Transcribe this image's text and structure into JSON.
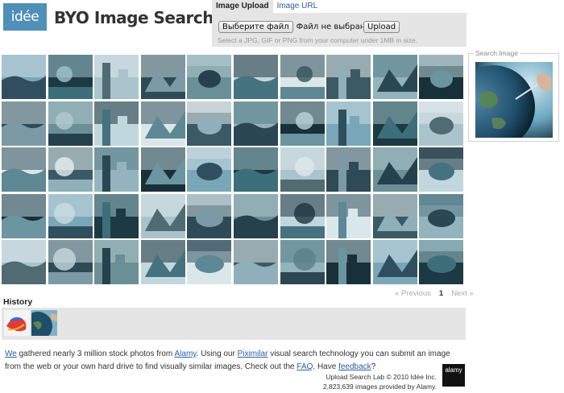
{
  "header": {
    "logo_text": "idée",
    "title": "BYO Image Search Lab"
  },
  "upload": {
    "tabs": [
      {
        "label": "Image Upload",
        "active": true
      },
      {
        "label": "Image URL",
        "active": false
      }
    ],
    "choose_file_label": "Выберите файл",
    "file_status": "Файл не выбран",
    "upload_button": "Upload",
    "hint": "Select a JPG, GIF or PNG from your computer under 1MB in size."
  },
  "search_image": {
    "legend": "Search Image"
  },
  "results": {
    "pager": {
      "previous": "« Previous",
      "current": "1",
      "next": "Next »"
    }
  },
  "history": {
    "title": "History"
  },
  "footer": {
    "t1": "We",
    "t2": " gathered nearly 3 million stock photos from ",
    "t3": "Alamy",
    "t4": ". Using our ",
    "t5": "Piximilar",
    "t6": " visual search technology you can submit an image from the web or your own hard drive to find visually similar images. Check out the ",
    "t7": "FAQ",
    "t8": ". Have ",
    "t9": "feedback",
    "t10": "?",
    "copyright_line1": "Upload Search Lab © 2010 Idée Inc.",
    "copyright_line2": "2,823,639 images provided by Alamy.",
    "alamy_logo": "alamy"
  },
  "colors": {
    "logo_bg": "#4f8fb8",
    "panel_bg": "#e5e5e5",
    "link": "#2a5d9f"
  }
}
